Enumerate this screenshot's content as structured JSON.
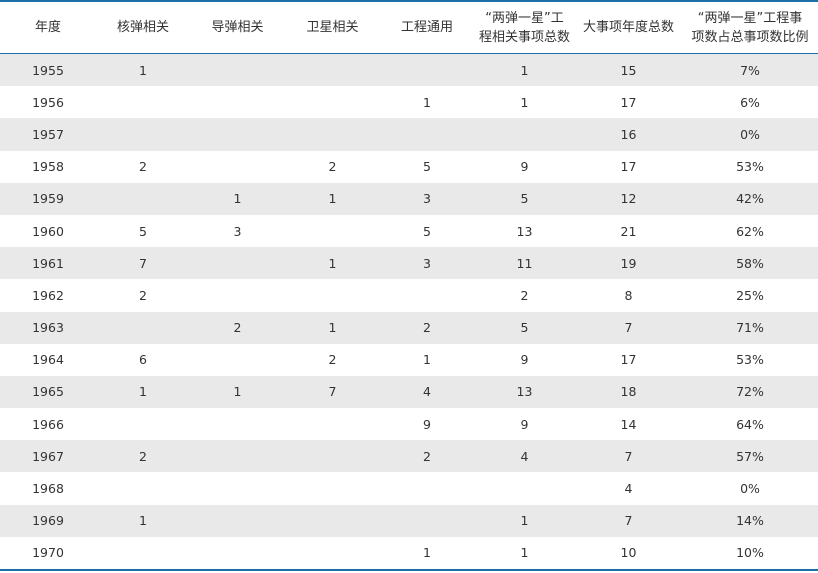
{
  "table": {
    "headers": [
      "年度",
      "核弹相关",
      "导弹相关",
      "卫星相关",
      "工程通用",
      "“两弹一星”工\n程相关事项总数",
      "大事项年度总数",
      "“两弹一星”工程事\n项数占总事项数比例"
    ],
    "rows": [
      [
        "1955",
        "1",
        "",
        "",
        "",
        "1",
        "15",
        "7%"
      ],
      [
        "1956",
        "",
        "",
        "",
        "1",
        "1",
        "17",
        "6%"
      ],
      [
        "1957",
        "",
        "",
        "",
        "",
        "",
        "16",
        "0%"
      ],
      [
        "1958",
        "2",
        "",
        "2",
        "5",
        "9",
        "17",
        "53%"
      ],
      [
        "1959",
        "",
        "1",
        "1",
        "3",
        "5",
        "12",
        "42%"
      ],
      [
        "1960",
        "5",
        "3",
        "",
        "5",
        "13",
        "21",
        "62%"
      ],
      [
        "1961",
        "7",
        "",
        "1",
        "3",
        "11",
        "19",
        "58%"
      ],
      [
        "1962",
        "2",
        "",
        "",
        "",
        "2",
        "8",
        "25%"
      ],
      [
        "1963",
        "",
        "2",
        "1",
        "2",
        "5",
        "7",
        "71%"
      ],
      [
        "1964",
        "6",
        "",
        "2",
        "1",
        "9",
        "17",
        "53%"
      ],
      [
        "1965",
        "1",
        "1",
        "7",
        "4",
        "13",
        "18",
        "72%"
      ],
      [
        "1966",
        "",
        "",
        "",
        "9",
        "9",
        "14",
        "64%"
      ],
      [
        "1967",
        "2",
        "",
        "",
        "2",
        "4",
        "7",
        "57%"
      ],
      [
        "1968",
        "",
        "",
        "",
        "",
        "",
        "4",
        "0%"
      ],
      [
        "1969",
        "1",
        "",
        "",
        "",
        "1",
        "7",
        "14%"
      ],
      [
        "1970",
        "",
        "",
        "",
        "1",
        "1",
        "10",
        "10%"
      ]
    ]
  },
  "colors": {
    "rule": "#1d6fa8",
    "stripe": "#e9e9e9",
    "text": "#333333"
  }
}
